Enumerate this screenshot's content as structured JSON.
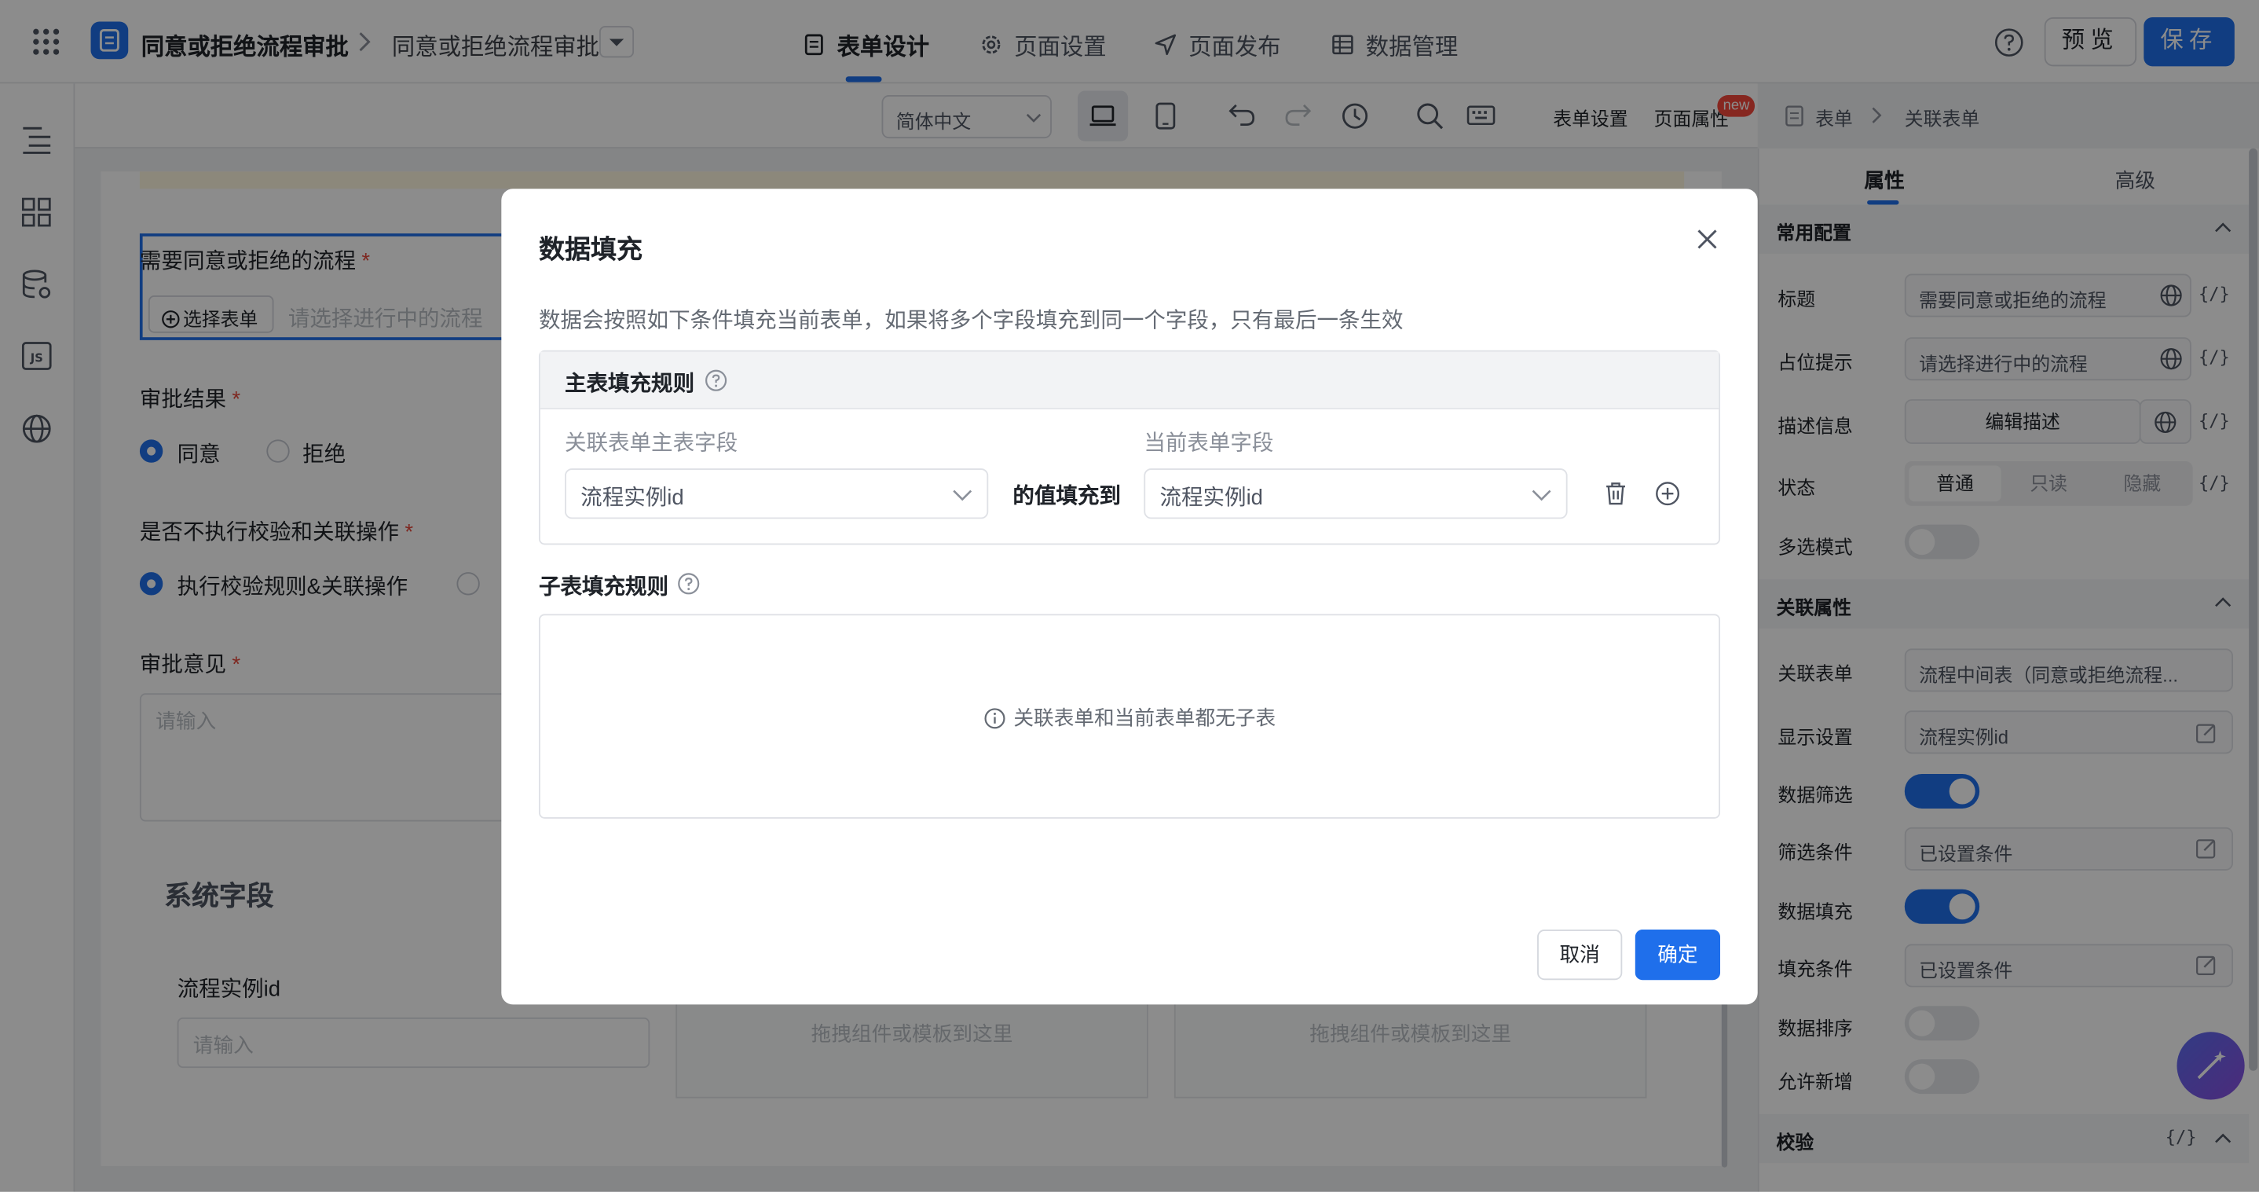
{
  "header": {
    "app_title": "同意或拒绝流程审批",
    "form_name": "同意或拒绝流程审批",
    "nav_tabs": [
      {
        "label": "表单设计",
        "icon": "document-icon"
      },
      {
        "label": "页面设置",
        "icon": "gear-icon"
      },
      {
        "label": "页面发布",
        "icon": "send-icon"
      },
      {
        "label": "数据管理",
        "icon": "table-icon"
      }
    ],
    "active_tab": "表单设计",
    "preview_label": "预览",
    "save_label": "保存"
  },
  "toolbar": {
    "language": "简体中文",
    "form_settings": "表单设置",
    "page_props": "页面属性",
    "badge_new": "new"
  },
  "canvas": {
    "field1_label": "需要同意或拒绝的流程",
    "field1_button": "选择表单",
    "field1_placeholder": "请选择进行中的流程",
    "field2_label": "审批结果",
    "field2_options": [
      "同意",
      "拒绝"
    ],
    "field3_label": "是否不执行校验和关联操作",
    "field3_option": "执行校验规则&关联操作",
    "field4_label": "审批意见",
    "field4_placeholder": "请输入",
    "system_section": "系统字段",
    "sys_field_label": "流程实例id",
    "sys_field_placeholder": "请输入",
    "drop_hint": "拖拽组件或模板到这里"
  },
  "right_panel": {
    "breadcrumb": [
      "表单",
      "关联表单"
    ],
    "tabs": [
      "属性",
      "高级"
    ],
    "active_tab": "属性",
    "common_section": "常用配置",
    "title_label": "标题",
    "title_value": "需要同意或拒绝的流程",
    "placeholder_label": "占位提示",
    "placeholder_value": "请选择进行中的流程",
    "desc_label": "描述信息",
    "desc_button": "编辑描述",
    "status_label": "状态",
    "status_options": [
      "普通",
      "只读",
      "隐藏"
    ],
    "status_selected": "普通",
    "multi_label": "多选模式",
    "multi_on": false,
    "link_section": "关联属性",
    "link_form_label": "关联表单",
    "link_form_value": "流程中间表（同意或拒绝流程...",
    "display_label": "显示设置",
    "display_value": "流程实例id",
    "filter_label": "数据筛选",
    "filter_on": true,
    "filter_cond_label": "筛选条件",
    "filter_cond_value": "已设置条件",
    "fill_label": "数据填充",
    "fill_on": true,
    "fill_cond_label": "填充条件",
    "fill_cond_value": "已设置条件",
    "sort_label": "数据排序",
    "sort_on": false,
    "allow_add_label": "允许新增",
    "allow_add_on": false,
    "validate_section": "校验",
    "expr_token": "{/}"
  },
  "modal": {
    "title": "数据填充",
    "description": "数据会按照如下条件填充当前表单，如果将多个字段填充到同一个字段，只有最后一条生效",
    "main_rules_title": "主表填充规则",
    "col_source": "关联表单主表字段",
    "col_target": "当前表单字段",
    "source_value": "流程实例id",
    "connector": "的值填充到",
    "target_value": "流程实例id",
    "sub_rules_title": "子表填充规则",
    "sub_empty": "关联表单和当前表单都无子表",
    "cancel_label": "取消",
    "ok_label": "确定"
  },
  "colors": {
    "primary": "#1f6feb",
    "required": "#e5483b",
    "badge": "#f5483b"
  }
}
